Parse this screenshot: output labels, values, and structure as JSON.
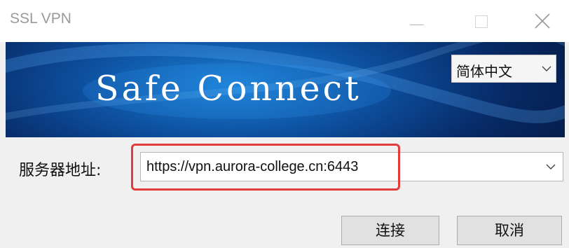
{
  "window": {
    "title": "SSL VPN"
  },
  "banner": {
    "brand_text": "Safe Connect",
    "language": {
      "selected": "简体中文"
    }
  },
  "form": {
    "server_label": "服务器地址:",
    "server_value": "https://vpn.aurora-college.cn:6443"
  },
  "buttons": {
    "connect_label": "连接",
    "cancel_label": "取消"
  },
  "colors": {
    "highlight": "#e23b3b",
    "banner_primary": "#0d4f9e"
  }
}
